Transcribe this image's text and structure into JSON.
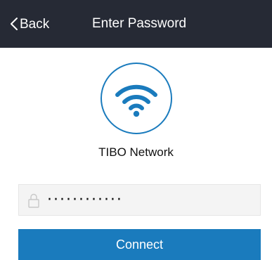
{
  "header": {
    "back_label": "Back",
    "title": "Enter Password"
  },
  "network": {
    "name": "TIBO Network",
    "icon": "wifi-icon"
  },
  "password": {
    "value": "············",
    "lock_icon": "lock-icon"
  },
  "actions": {
    "connect_label": "Connect"
  },
  "colors": {
    "header_bg": "#262a35",
    "accent": "#1a7bbd",
    "input_bg": "#f4f4f4"
  }
}
